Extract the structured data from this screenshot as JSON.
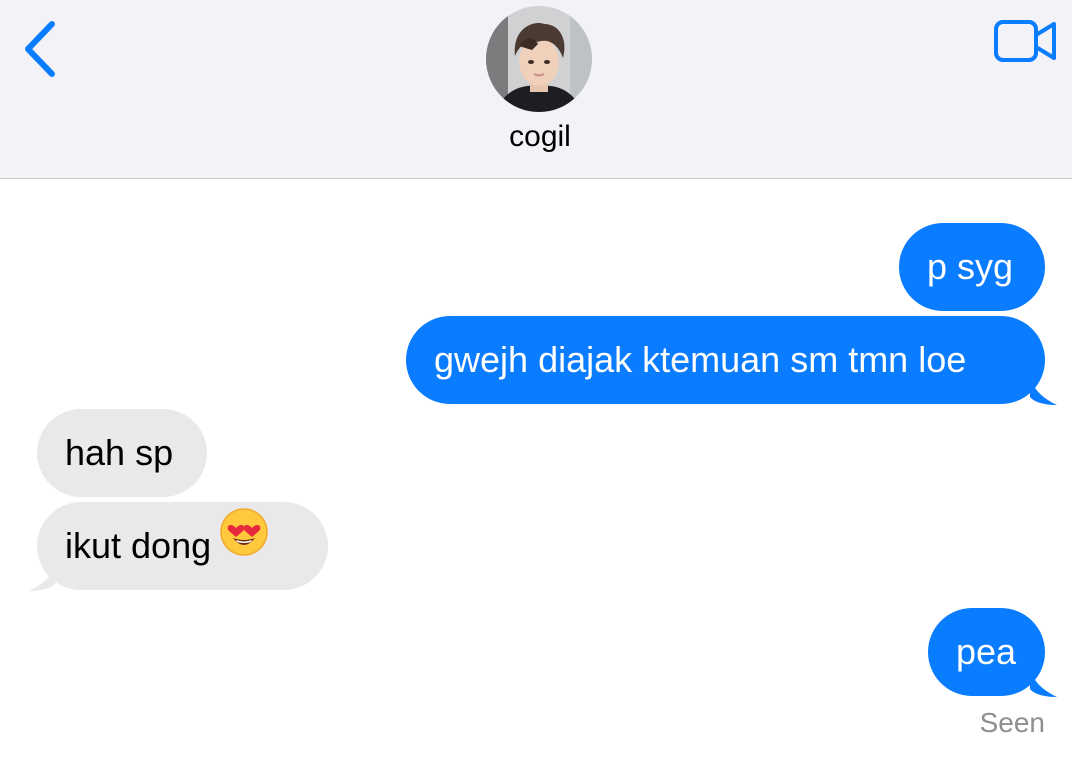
{
  "header": {
    "contact_name": "cogil",
    "back_icon": "chevron-left-icon",
    "video_icon": "video-camera-icon",
    "accent_color": "#0a7cff"
  },
  "messages": [
    {
      "direction": "sent",
      "text": "p syg"
    },
    {
      "direction": "sent",
      "text": "gwejh diajak ktemuan sm tmn loe"
    },
    {
      "direction": "received",
      "text": "hah sp"
    },
    {
      "direction": "received",
      "text": "ikut dong",
      "emoji": "heart-eyes-emoji"
    },
    {
      "direction": "sent",
      "text": "pea"
    }
  ],
  "status": {
    "seen": "Seen"
  },
  "colors": {
    "sent_bubble": "#0a7cff",
    "received_bubble": "#e9e9eb",
    "header_bg": "#f2f2f7"
  }
}
